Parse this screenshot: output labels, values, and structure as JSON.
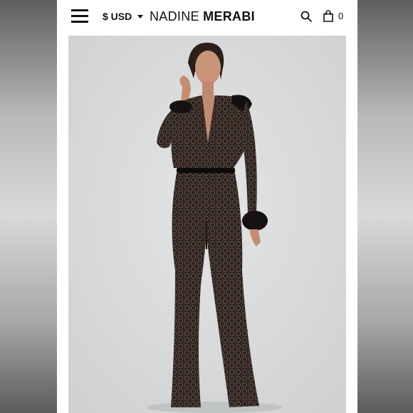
{
  "header": {
    "currency_label": "$ USD",
    "brand_part1": "NADINE ",
    "brand_part2": "MERABI",
    "cart_count": "0",
    "icons": [
      "hamburger-menu-icon",
      "chevron-down-icon",
      "search-icon",
      "shopping-bag-icon"
    ]
  },
  "main": {
    "product_image": "model wearing black sequin jumpsuit with feather cuffs"
  },
  "colors": {
    "page_background": "#ffffff",
    "photo_background": "#d7d9d9",
    "text": "#111111"
  }
}
